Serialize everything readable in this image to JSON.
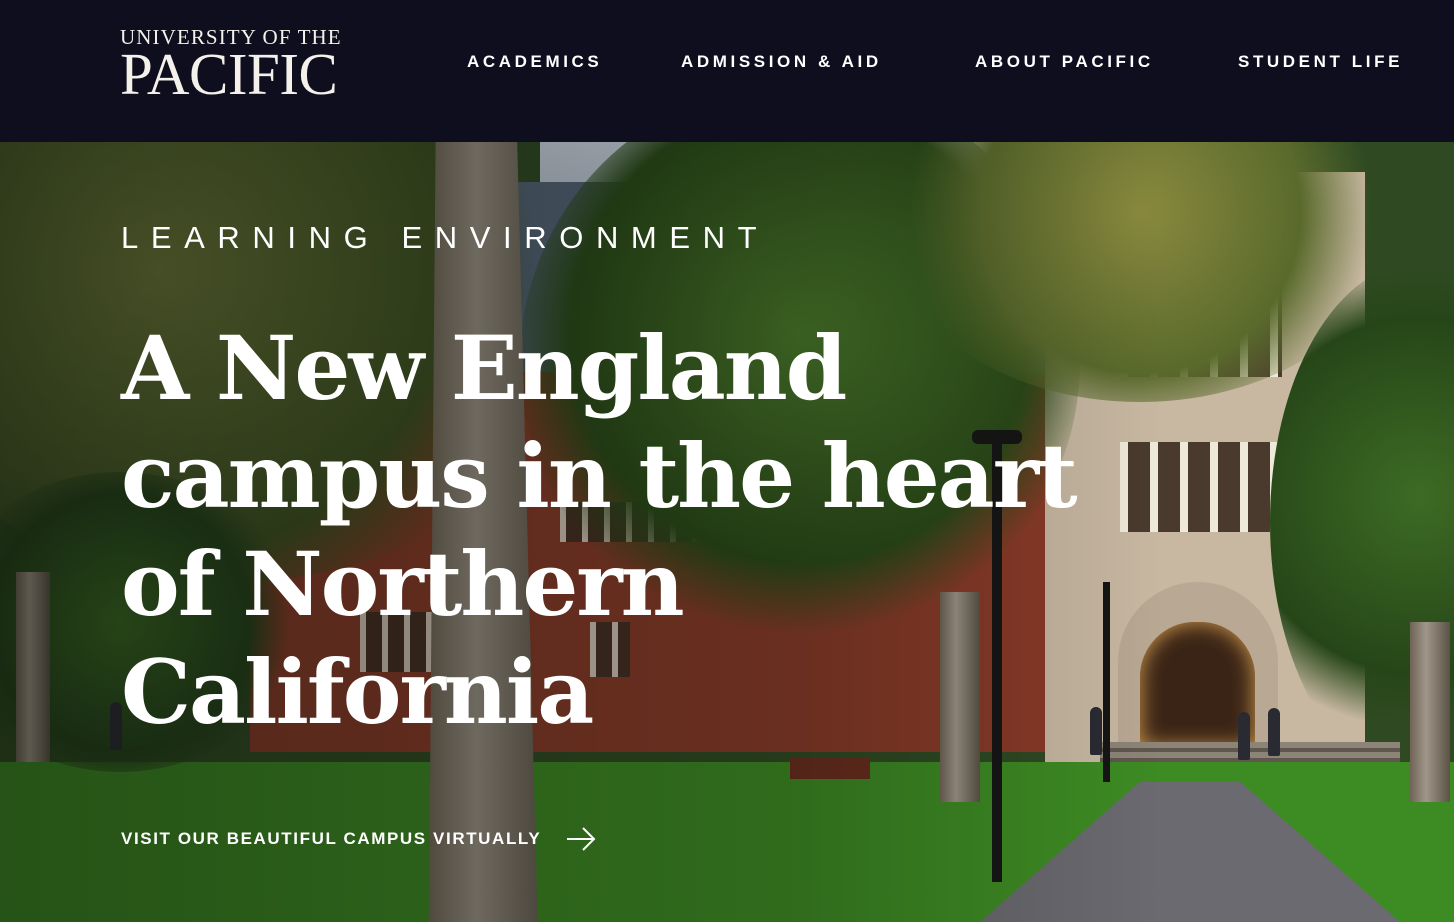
{
  "header": {
    "logo": {
      "line1": "UNIVERSITY OF THE",
      "line2": "PACIFIC"
    },
    "nav": [
      {
        "label": "ACADEMICS"
      },
      {
        "label": "ADMISSION & AID"
      },
      {
        "label": "ABOUT PACIFIC"
      },
      {
        "label": "STUDENT LIFE"
      }
    ]
  },
  "hero": {
    "eyebrow": "LEARNING ENVIRONMENT",
    "headline": "A New England campus in the heart of Northern California",
    "cta": {
      "label": "VISIT OUR BEAUTIFUL CAMPUS VIRTUALLY",
      "icon": "arrow-right-icon"
    },
    "background_image": "campus-building-photo"
  },
  "colors": {
    "header_bg": "#0e0e1f",
    "text": "#ffffff"
  }
}
